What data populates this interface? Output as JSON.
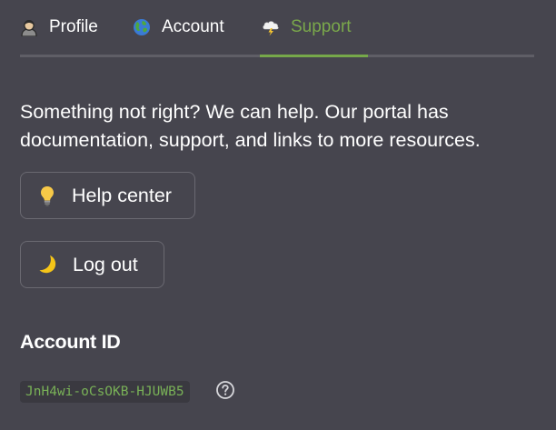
{
  "tabs": [
    {
      "label": "Profile",
      "icon": "person-emoji-icon",
      "active": false
    },
    {
      "label": "Account",
      "icon": "globe-emoji-icon",
      "active": false
    },
    {
      "label": "Support",
      "icon": "cloud-lightning-emoji-icon",
      "active": true
    }
  ],
  "support": {
    "intro": "Something not right? We can help. Our portal has documentation, support, and links to more resources.",
    "help_center_label": "Help center",
    "help_center_icon": "lightbulb-icon",
    "log_out_label": "Log out",
    "log_out_icon": "crescent-moon-icon",
    "account_id_heading": "Account ID",
    "account_id_value": "JnH4wi-oCsOKB-HJUWB5",
    "account_id_help_icon": "question-circle-icon"
  },
  "colors": {
    "background": "#46454e",
    "accent": "#76a84a",
    "account_id_text": "#79b157",
    "chip_background": "#3a3940",
    "divider": "#5f5e66"
  }
}
